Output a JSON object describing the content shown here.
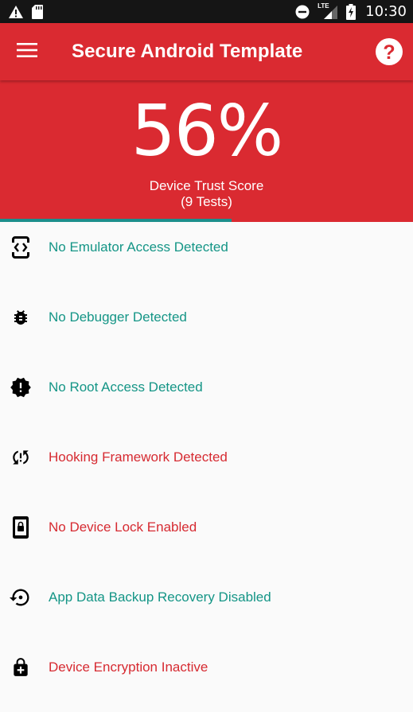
{
  "status_bar": {
    "network": "LTE",
    "time": "10:30"
  },
  "app_bar": {
    "title": "Secure Android Template",
    "menu_icon": "hamburger-menu-icon",
    "help_icon": "help-circle-icon"
  },
  "score": {
    "value": "56%",
    "label": "Device Trust Score",
    "sub_label": "(9 Tests)",
    "progress_fraction": 0.56,
    "background_color": "#da2a31",
    "progress_color": "#1c8f8c"
  },
  "colors": {
    "pass": "#149586",
    "fail": "#d62a31"
  },
  "checks": [
    {
      "label": "No Emulator Access Detected",
      "status": "pass",
      "icon": "developer-mode-icon"
    },
    {
      "label": "No Debugger Detected",
      "status": "pass",
      "icon": "bug-icon"
    },
    {
      "label": "No Root Access Detected",
      "status": "pass",
      "icon": "new-releases-badge-icon"
    },
    {
      "label": "Hooking Framework Detected",
      "status": "fail",
      "icon": "sync-problem-icon"
    },
    {
      "label": "No Device Lock Enabled",
      "status": "fail",
      "icon": "screen-lock-icon"
    },
    {
      "label": "App Data Backup Recovery Disabled",
      "status": "pass",
      "icon": "backup-restore-icon"
    },
    {
      "label": "Device Encryption Inactive",
      "status": "fail",
      "icon": "enhanced-encryption-icon"
    }
  ]
}
